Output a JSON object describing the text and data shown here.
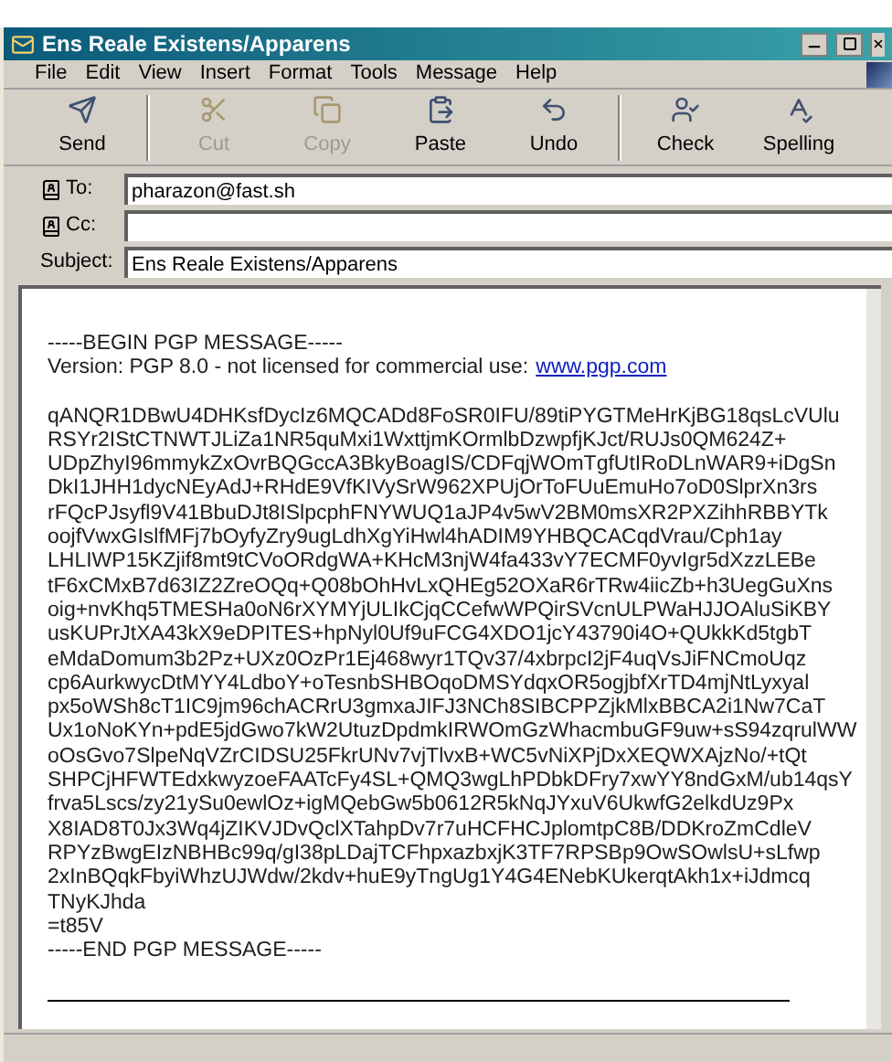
{
  "window": {
    "title": "Ens Reale Existens/Apparens"
  },
  "menu": [
    "File",
    "Edit",
    "View",
    "Insert",
    "Format",
    "Tools",
    "Message",
    "Help"
  ],
  "toolbar": [
    {
      "label": "Send",
      "kind": "send",
      "disabled": false
    },
    {
      "label": "Cut",
      "kind": "cut",
      "disabled": true
    },
    {
      "label": "Copy",
      "kind": "copy",
      "disabled": true
    },
    {
      "label": "Paste",
      "kind": "paste",
      "disabled": false
    },
    {
      "label": "Undo",
      "kind": "undo",
      "disabled": false
    },
    {
      "label": "Check",
      "kind": "check",
      "disabled": false
    },
    {
      "label": "Spelling",
      "kind": "spelling",
      "disabled": false
    }
  ],
  "headers": [
    {
      "label": "To:",
      "kind": "address",
      "value": "pharazon@fast.sh"
    },
    {
      "label": "Cc:",
      "kind": "address"
    },
    {
      "label": "Subject:",
      "kind": "plain",
      "value": "Ens Reale Existens/Apparens"
    }
  ],
  "body": {
    "begin": "-----BEGIN PGP MESSAGE-----",
    "version": "Version: PGP 8.0 - not licensed for commercial use:",
    "link": "www.pgp.com",
    "cipher_lines": [
      "qANQR1DBwU4DHKsfDycIz6MQCADd8FoSR0IFU/89tiPYGTMeHrKjBG18qsLcVUlu",
      "RSYr2IStCTNWTJLiZa1NR5quMxi1WxttjmKOrmlbDzwpfjKJct/RUJs0QM624Z+",
      "UDpZhyI96mmykZxOvrBQGccA3BkyBoagIS/CDFqjWOmTgfUtIRoDLnWAR9+iDgSn",
      "DkI1JHH1dycNEyAdJ+RHdE9VfKIVySrW962XPUjOrToFUuEmuHo7oD0SlprXn3rs",
      "rFQcPJsyfl9V41BbuDJt8ISlpcphFNYWUQ1aJP4v5wV2BM0msXR2PXZihhRBBYTk",
      "oojfVwxGIslfMFj7bOyfyZry9ugLdhXgYiHwl4hADIM9YHBQCACqdVrau/Cph1ay",
      "LHLIWP15KZjif8mt9tCVoORdgWA+KHcM3njW4fa433vY7ECMF0yvIgr5dXzzLEBe",
      "tF6xCMxB7d63IZ2ZreOQq+Q08bOhHvLxQHEg52OXaR6rTRw4iicZb+h3UegGuXns",
      "oig+nvKhq5TMESHa0oN6rXYMYjULIkCjqCCefwWPQirSVcnULPWaHJJOAluSiKBY",
      "usKUPrJtXA43kX9eDPITES+hpNyl0Uf9uFCG4XDO1jcY43790i4O+QUkkKd5tgbT",
      "eMdaDomum3b2Pz+UXz0OzPr1Ej468wyr1TQv37/4xbrpcI2jF4uqVsJiFNCmoUqz",
      "cp6AurkwycDtMYY4LdboY+oTesnbSHBOqoDMSYdqxOR5ogjbfXrTD4mjNtLyxyal",
      "px5oWSh8cT1IC9jm96chACRrU3gmxaJIFJ3NCh8SIBCPPZjkMlxBBCA2i1Nw7CaT",
      "Ux1oNoKYn+pdE5jdGwo7kW2UtuzDpdmkIRWOmGzWhacmbuGF9uw+sS94zqrulWW",
      "oOsGvo7SlpeNqVZrCIDSU25FkrUNv7vjTlvxB+WC5vNiXPjDxXEQWXAjzNo/+tQt",
      "SHPCjHFWTEdxkwyzoeFAATcFy4SL+QMQ3wgLhPDbkDFry7xwYY8ndGxM/ub14qsY",
      "frva5Lscs/zy21ySu0ewlOz+igMQebGw5b0612R5kNqJYxuV6UkwfG2elkdUz9Px",
      "X8IAD8T0Jx3Wq4jZIKVJDvQclXTahpDv7r7uHCFHCJplomtpC8B/DDKroZmCdleV",
      "RPYzBwgEIzNBHBc99q/gI38pLDajTCFhpxazbxjK3TF7RPSBp9OwSOwlsU+sLfwp",
      "2xInBQqkFbyiWhzUJWdw/2kdv+huE9yTngUg1Y4G4ENebKUkerqtAkh1x+iJdmcq",
      "TNyKJhda",
      "=t85V"
    ],
    "end": "-----END PGP MESSAGE-----"
  }
}
